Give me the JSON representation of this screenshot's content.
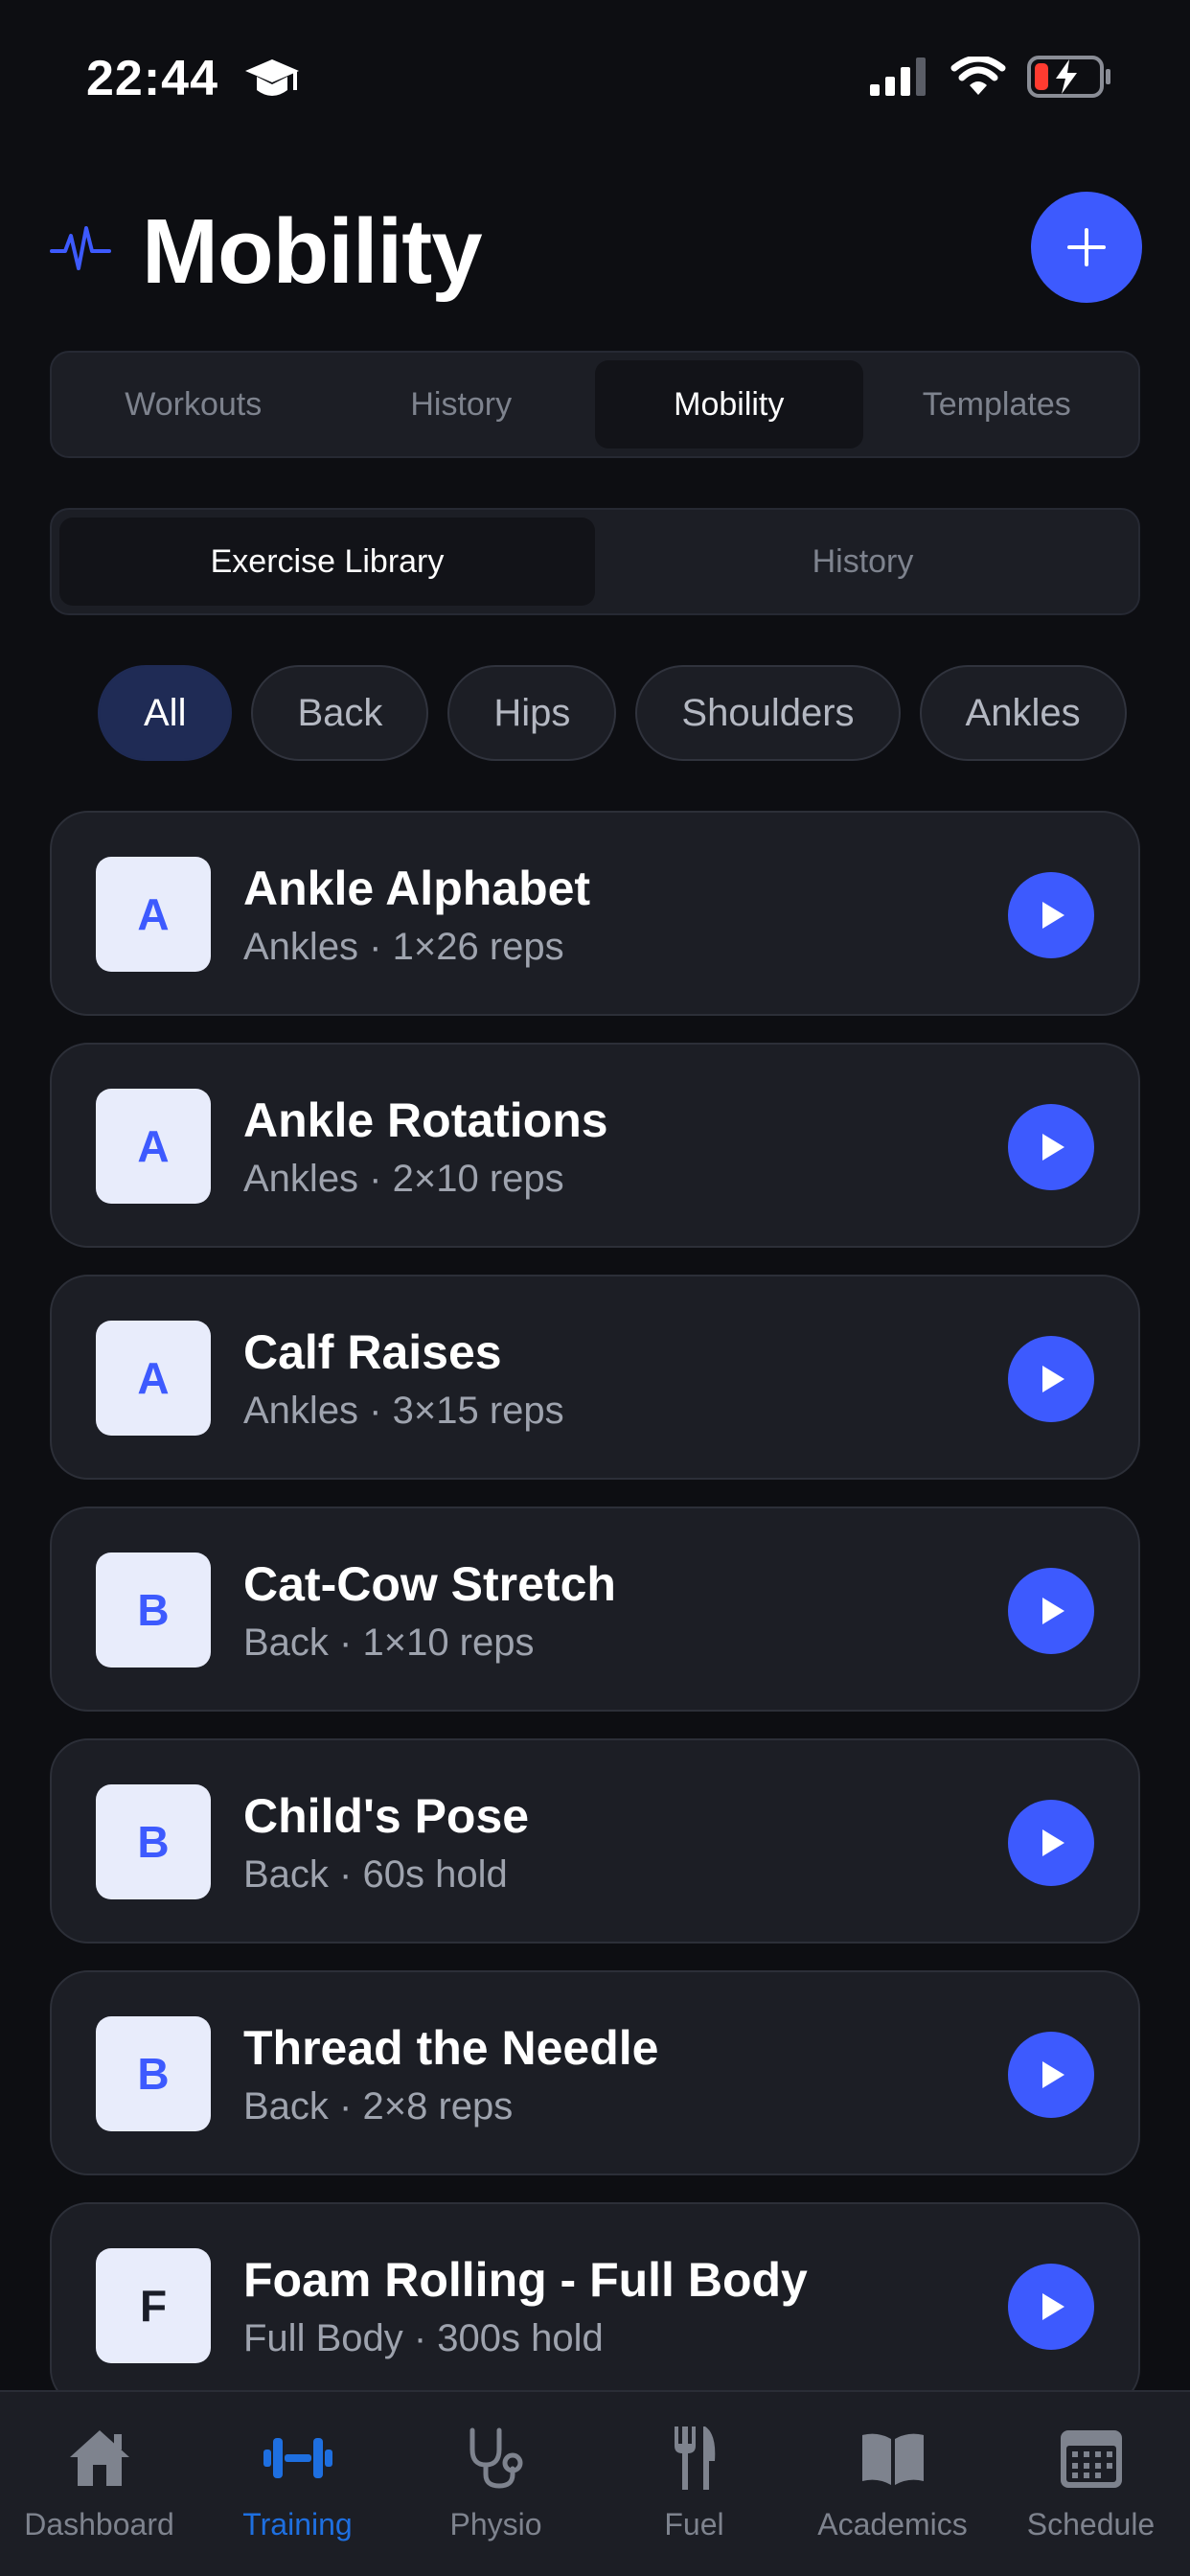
{
  "status_bar": {
    "time": "22:44"
  },
  "header": {
    "title": "Mobility"
  },
  "primary_tabs": [
    {
      "label": "Workouts",
      "active": false
    },
    {
      "label": "History",
      "active": false
    },
    {
      "label": "Mobility",
      "active": true
    },
    {
      "label": "Templates",
      "active": false
    }
  ],
  "secondary_tabs": [
    {
      "label": "Exercise Library",
      "active": true
    },
    {
      "label": "History",
      "active": false
    }
  ],
  "filters": [
    {
      "label": "All",
      "active": true
    },
    {
      "label": "Back",
      "active": false
    },
    {
      "label": "Hips",
      "active": false
    },
    {
      "label": "Shoulders",
      "active": false
    },
    {
      "label": "Ankles",
      "active": false
    }
  ],
  "exercises": [
    {
      "letter": "A",
      "name": "Ankle Alphabet",
      "meta": "Ankles · 1×26 reps"
    },
    {
      "letter": "A",
      "name": "Ankle Rotations",
      "meta": "Ankles · 2×10 reps"
    },
    {
      "letter": "A",
      "name": "Calf Raises",
      "meta": "Ankles · 3×15 reps"
    },
    {
      "letter": "B",
      "name": "Cat-Cow Stretch",
      "meta": "Back · 1×10 reps"
    },
    {
      "letter": "B",
      "name": "Child's Pose",
      "meta": "Back · 60s hold"
    },
    {
      "letter": "B",
      "name": "Thread the Needle",
      "meta": "Back · 2×8 reps"
    },
    {
      "letter": "F",
      "name": "Foam Rolling - Full Body",
      "meta": "Full Body · 300s hold"
    }
  ],
  "bottom_nav": [
    {
      "label": "Dashboard",
      "icon": "house-icon",
      "active": false
    },
    {
      "label": "Training",
      "icon": "dumbbell-icon",
      "active": true
    },
    {
      "label": "Physio",
      "icon": "stethoscope-icon",
      "active": false
    },
    {
      "label": "Fuel",
      "icon": "fork-knife-icon",
      "active": false
    },
    {
      "label": "Academics",
      "icon": "book-icon",
      "active": false
    },
    {
      "label": "Schedule",
      "icon": "calendar-icon",
      "active": false
    }
  ],
  "colors": {
    "background": "#0d0e12",
    "surface": "#1c1e25",
    "accent": "#3d5afe",
    "nav_active": "#1e6fe0",
    "chip_active": "#1f2b55"
  }
}
